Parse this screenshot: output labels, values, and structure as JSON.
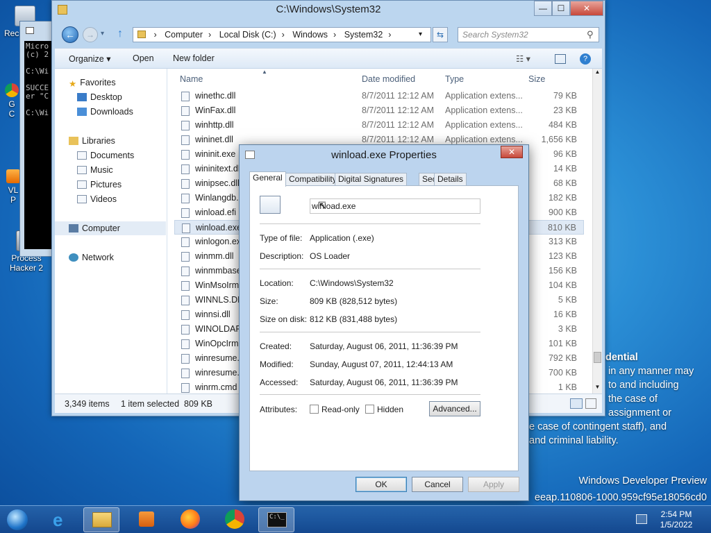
{
  "desktop": {
    "icons": [
      {
        "label": "Rec",
        "icon": "recycle-bin-icon"
      },
      {
        "label": "G\nC",
        "icon": "chrome-icon"
      },
      {
        "label": "VL\nP",
        "icon": "vlc-icon"
      },
      {
        "label": "Process\nHacker 2",
        "icon": "process-hacker-icon"
      }
    ],
    "legal_title": "dential",
    "legal_lines": [
      "in any manner may",
      "to and including",
      "the case of",
      "assignment or"
    ],
    "legal_lines2": [
      "e case of contingent staff), and",
      "and criminal liability."
    ],
    "watermark_line1": "Windows Developer Preview",
    "watermark_line2": "eeap.110806-1000.959cf95e18056cd0"
  },
  "cmd": {
    "lines": "Micro\n(c) 2\n\nC:\\Wi\n\nSUCCE\ner \"C\n\nC:\\Wi"
  },
  "explorer": {
    "title": "C:\\Windows\\System32",
    "window_controls": [
      "—",
      "☐",
      "✕"
    ],
    "breadcrumb": [
      "Computer",
      "Local Disk (C:)",
      "Windows",
      "System32"
    ],
    "search_placeholder": "Search System32",
    "toolbar": {
      "organize": "Organize ▾",
      "open": "Open",
      "new_folder": "New folder"
    },
    "nav": {
      "favorites": "Favorites",
      "desktop": "Desktop",
      "downloads": "Downloads",
      "libraries": "Libraries",
      "documents": "Documents",
      "music": "Music",
      "pictures": "Pictures",
      "videos": "Videos",
      "computer": "Computer",
      "network": "Network"
    },
    "columns": {
      "name": "Name",
      "date": "Date modified",
      "type": "Type",
      "size": "Size"
    },
    "files": [
      {
        "name": "winethc.dll",
        "date": "8/7/2011 12:12 AM",
        "type": "Application extens...",
        "size": "79 KB"
      },
      {
        "name": "WinFax.dll",
        "date": "8/7/2011 12:12 AM",
        "type": "Application extens...",
        "size": "23 KB"
      },
      {
        "name": "winhttp.dll",
        "date": "8/7/2011 12:12 AM",
        "type": "Application extens...",
        "size": "484 KB"
      },
      {
        "name": "wininet.dll",
        "date": "8/7/2011 12:12 AM",
        "type": "Application extens...",
        "size": "1,656 KB"
      },
      {
        "name": "wininit.exe",
        "date": "",
        "type": "",
        "size": "96 KB"
      },
      {
        "name": "wininitext.dll",
        "date": "",
        "type": "",
        "size": "14 KB"
      },
      {
        "name": "winipsec.dll",
        "date": "",
        "type": "",
        "size": "68 KB"
      },
      {
        "name": "Winlangdb.dll",
        "date": "",
        "type": "",
        "size": "182 KB"
      },
      {
        "name": "winload.efi",
        "date": "",
        "type": "",
        "size": "900 KB"
      },
      {
        "name": "winload.exe",
        "date": "",
        "type": "",
        "size": "810 KB"
      },
      {
        "name": "winlogon.exe",
        "date": "",
        "type": "",
        "size": "313 KB"
      },
      {
        "name": "winmm.dll",
        "date": "",
        "type": "",
        "size": "123 KB"
      },
      {
        "name": "winmmbase.dll",
        "date": "",
        "type": "",
        "size": "156 KB"
      },
      {
        "name": "WinMsoIrm.dll",
        "date": "",
        "type": "",
        "size": "104 KB"
      },
      {
        "name": "WINNLS.DLL",
        "date": "",
        "type": "",
        "size": "5 KB"
      },
      {
        "name": "winnsi.dll",
        "date": "",
        "type": "",
        "size": "16 KB"
      },
      {
        "name": "WINOLDAP.MOD",
        "date": "",
        "type": "",
        "size": "3 KB"
      },
      {
        "name": "WinOpcIrm.dll",
        "date": "",
        "type": "",
        "size": "101 KB"
      },
      {
        "name": "winresume.efi",
        "date": "",
        "type": "",
        "size": "792 KB"
      },
      {
        "name": "winresume.exe",
        "date": "",
        "type": "",
        "size": "700 KB"
      },
      {
        "name": "winrm.cmd",
        "date": "",
        "type": "",
        "size": "1 KB"
      }
    ],
    "status_count": "3,349 items",
    "status_selected": "1 item selected  809 KB"
  },
  "dialog": {
    "title": "winload.exe Properties",
    "close": "✕",
    "tabs": [
      "General",
      "Compatibility",
      "Digital Signatures",
      "Security",
      "Details"
    ],
    "filename": "winload.exe",
    "labels": {
      "type": "Type of file:",
      "description": "Description:",
      "location": "Location:",
      "size": "Size:",
      "size_on_disk": "Size on disk:",
      "created": "Created:",
      "modified": "Modified:",
      "accessed": "Accessed:",
      "attributes": "Attributes:"
    },
    "values": {
      "type": "Application (.exe)",
      "description": "OS Loader",
      "location": "C:\\Windows\\System32",
      "size": "809 KB (828,512 bytes)",
      "size_on_disk": "812 KB (831,488 bytes)",
      "created": "Saturday, August 06, 2011, 11:36:39 PM",
      "modified": "Sunday, August 07, 2011, 12:44:13 AM",
      "accessed": "Saturday, August 06, 2011, 11:36:39 PM"
    },
    "readonly": "Read-only",
    "hidden": "Hidden",
    "advanced": "Advanced...",
    "ok": "OK",
    "cancel": "Cancel",
    "apply": "Apply"
  },
  "taskbar": {
    "time": "2:54 PM",
    "date": "1/5/2022"
  }
}
